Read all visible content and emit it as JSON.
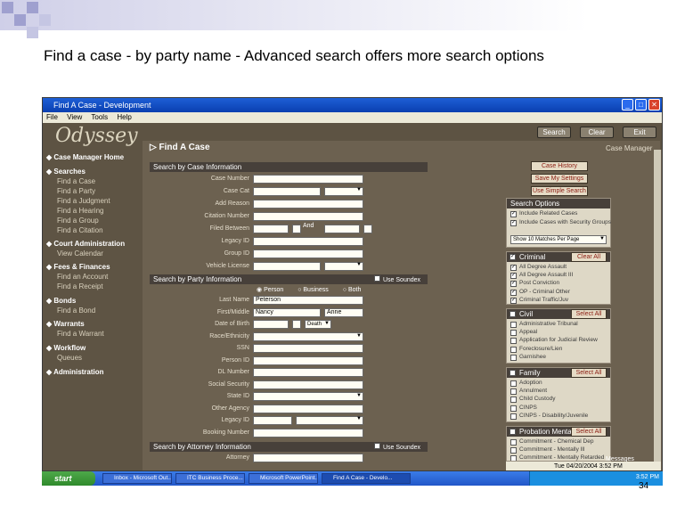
{
  "slide": {
    "title": "Find a case - by party name - Advanced search offers more search options",
    "page_number": "34",
    "deco_colors": [
      "#9999cc",
      "#9999cc",
      "#9999cc",
      "#9999cc",
      "#9999cc"
    ]
  },
  "window": {
    "title": "Find A Case - Development",
    "menu": [
      "File",
      "View",
      "Tools",
      "Help"
    ],
    "logo": "Odyssey",
    "toolbar": {
      "search": "Search",
      "clear": "Clear",
      "exit": "Exit",
      "case_manager": "Case Manager"
    }
  },
  "nav": {
    "sections": [
      {
        "label": "◆ Case Manager Home",
        "items": []
      },
      {
        "label": "◆ Searches",
        "items": [
          "Find a Case",
          "Find a Party",
          "Find a Judgment",
          "Find a Hearing",
          "Find a Group",
          "Find a Citation"
        ]
      },
      {
        "label": "◆ Court Administration",
        "items": [
          "View Calendar"
        ]
      },
      {
        "label": "◆ Fees & Finances",
        "items": [
          "Find an Account",
          "Find a Receipt"
        ]
      },
      {
        "label": "◆ Bonds",
        "items": [
          "Find a Bond"
        ]
      },
      {
        "label": "◆ Warrants",
        "items": [
          "Find a Warrant"
        ]
      },
      {
        "label": "◆ Workflow",
        "items": [
          "Queues"
        ]
      },
      {
        "label": "◆ Administration",
        "items": []
      }
    ]
  },
  "main": {
    "heading": "Find A Case",
    "case_info_header": "Search by Case Information",
    "case_fields": [
      "Case Number",
      "Case Cat",
      "Add Reason",
      "Citation Number",
      "Filed Between",
      "Legacy ID",
      "Group ID",
      "Vehicle License"
    ],
    "filed_and": "And",
    "party_header": "Search by Party Information",
    "soundex_label": "Use Soundex",
    "party_types": [
      "Person",
      "Business",
      "Both"
    ],
    "party_fields": [
      "Last Name",
      "First/Middle",
      "Date of Birth",
      "Race/Ethnicity",
      "SSN",
      "Person ID",
      "DL Number",
      "Social Security",
      "State ID",
      "Other Agency",
      "Legacy ID",
      "Booking Number"
    ],
    "last_name": "Peterson",
    "first_name": "Nancy",
    "middle_name": "Anne",
    "dob_suffix": "Death",
    "attorney_header": "Search by Attorney Information",
    "attorney_field": "Attorney"
  },
  "right": {
    "buttons": [
      "Case History",
      "Save My Settings",
      "Use Simple Search"
    ],
    "options_header": "Search Options",
    "options": [
      {
        "label": "Include Related Cases",
        "checked": true
      },
      {
        "label": "Include Cases with Security Groups",
        "checked": true
      }
    ],
    "show_select": "Show 10 Matches Per Page",
    "categories": [
      {
        "name": "Criminal",
        "checked": true,
        "items": [
          {
            "t": "All Degree Assault",
            "c": true
          },
          {
            "t": "All Degree Assault III",
            "c": true
          },
          {
            "t": "Post Conviction",
            "c": true
          },
          {
            "t": "OP - Criminal Other",
            "c": true
          },
          {
            "t": "Criminal Traffic/Juv",
            "c": true
          }
        ]
      },
      {
        "name": "Civil",
        "checked": false,
        "items": [
          {
            "t": "Administrative Tribunal",
            "c": false
          },
          {
            "t": "Appeal",
            "c": false
          },
          {
            "t": "Application for Judicial Review",
            "c": false
          },
          {
            "t": "Foreclosure/Lien",
            "c": false
          },
          {
            "t": "Garnishee",
            "c": false
          }
        ]
      },
      {
        "name": "Family",
        "checked": false,
        "items": [
          {
            "t": "Adoption",
            "c": false
          },
          {
            "t": "Annulment",
            "c": false
          },
          {
            "t": "Child Custody",
            "c": false
          },
          {
            "t": "CINPS",
            "c": false
          },
          {
            "t": "CINPS - Disability/Juvenile",
            "c": false
          }
        ]
      },
      {
        "name": "Probation Mental",
        "checked": false,
        "items": [
          {
            "t": "Commitment - Chemical Dep",
            "c": false
          },
          {
            "t": "Commitment - Mentally Ill",
            "c": false
          },
          {
            "t": "Commitment - Mentally Retarded",
            "c": false
          }
        ]
      }
    ],
    "select_all": "Select All",
    "clear_all": "Clear All",
    "version": "Messages",
    "status_date": "Tue 04/20/2004 3:52 PM"
  },
  "taskbar": {
    "start": "start",
    "tasks": [
      "Inbox - Microsoft Out...",
      "ITC Business Proce...",
      "Microsoft PowerPoint...",
      "Find A Case - Develo..."
    ],
    "clock": "3:52 PM"
  }
}
